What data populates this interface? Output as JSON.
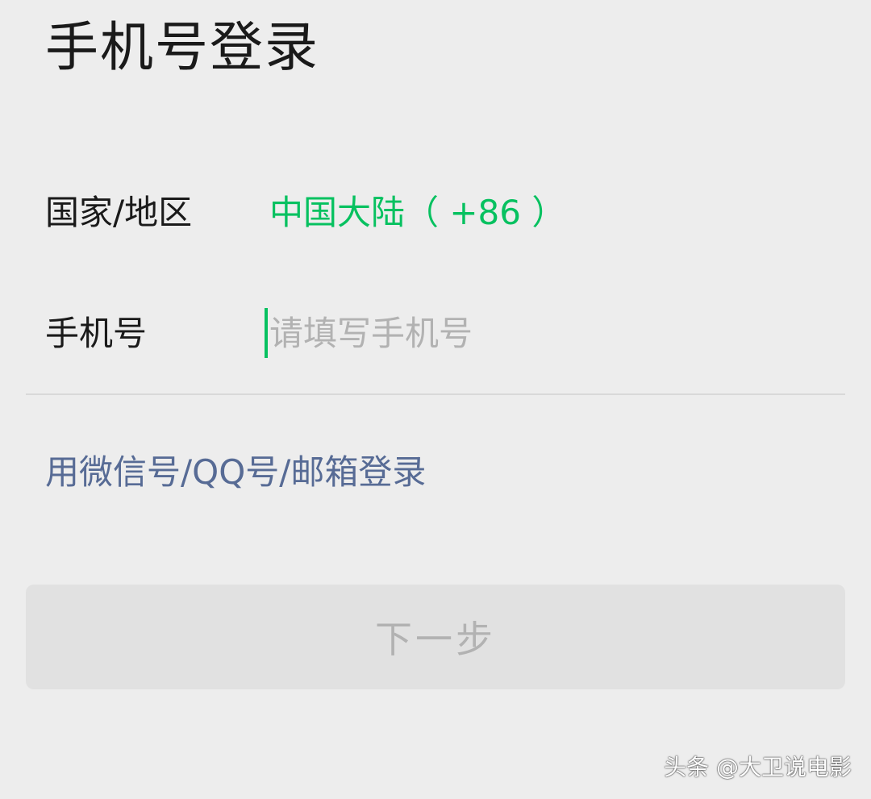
{
  "page": {
    "title": "手机号登录"
  },
  "form": {
    "country_label": "国家/地区",
    "country_value": "中国大陆（ +86 ）",
    "phone_label": "手机号",
    "phone_value": "",
    "phone_placeholder": "请填写手机号"
  },
  "alt_login": {
    "label": "用微信号/QQ号/邮箱登录"
  },
  "actions": {
    "next_label": "下一步",
    "next_enabled": false
  },
  "watermark": {
    "text": "头条 @大卫说电影"
  },
  "colors": {
    "background": "#ededed",
    "accent_green": "#07c160",
    "link_blue": "#576b95",
    "placeholder_gray": "#b2b2b2",
    "button_disabled_bg": "#e1e1e1"
  }
}
